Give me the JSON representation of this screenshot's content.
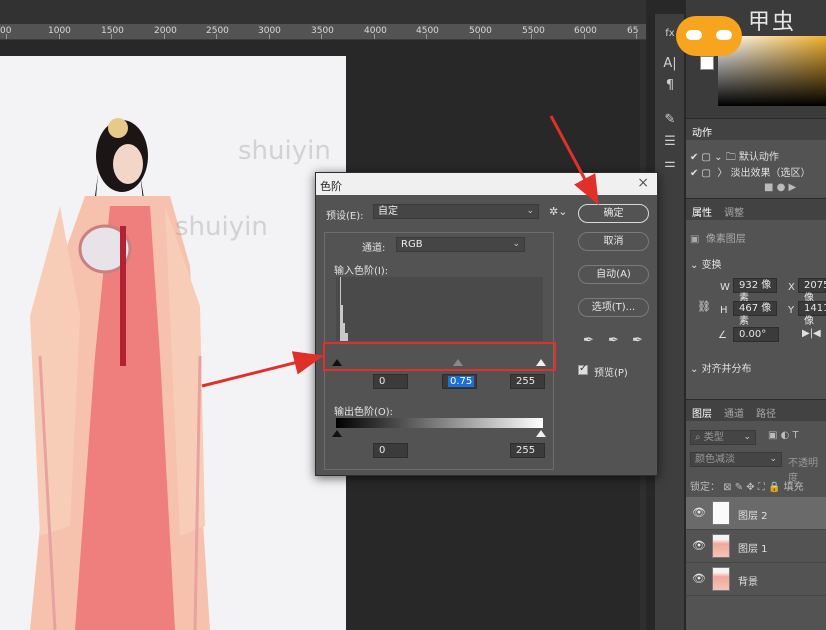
{
  "ruler": {
    "ticks": [
      "00",
      "1000",
      "1500",
      "2000",
      "2500",
      "3000",
      "3500",
      "4000",
      "4500",
      "5000",
      "5500",
      "6000",
      "65"
    ]
  },
  "canvas": {
    "watermarks": [
      "shuiyin",
      "shuiyin"
    ]
  },
  "brand": {
    "logo_text": "甲虫"
  },
  "right_panel": {
    "actions_tab": "动作",
    "actions": [
      "默认动作",
      "淡出效果（选区）"
    ],
    "properties_tabs": [
      "属性",
      "调整"
    ],
    "pixel_layer": "像素图层",
    "transform_label": "变换",
    "w_label": "W",
    "w_value": "932 像素",
    "h_label": "H",
    "h_value": "467 像素",
    "x_label": "X",
    "x_value": "2075 像",
    "y_label": "Y",
    "y_value": "1411 像",
    "angle_value": "0.00°",
    "align_label": "对齐并分布",
    "layers_tabs": [
      "图层",
      "通道",
      "路径"
    ],
    "kind_placeholder": "类型",
    "blend_mode": "颜色减淡",
    "opacity_label": "不透明度",
    "lock_label": "锁定：",
    "fill_label": "填充",
    "layers": [
      {
        "name": "图层 2"
      },
      {
        "name": "图层 1"
      },
      {
        "name": "背景"
      }
    ]
  },
  "dialog": {
    "title": "色阶",
    "preset_label": "预设(E):",
    "preset_value": "自定",
    "channel_label": "通道:",
    "channel_value": "RGB",
    "input_label": "输入色阶(I):",
    "input_values": {
      "black": "0",
      "gamma": "0.75",
      "white": "255"
    },
    "output_label": "输出色阶(O):",
    "output_values": {
      "black": "0",
      "white": "255"
    },
    "buttons": {
      "ok": "确定",
      "cancel": "取消",
      "auto": "自动(A)",
      "options": "选项(T)..."
    },
    "preview_label": "预览(P)",
    "preview_checked": true
  },
  "colors": {
    "annotation_red": "#e0302a",
    "selection_blue": "#1d6fd6"
  }
}
